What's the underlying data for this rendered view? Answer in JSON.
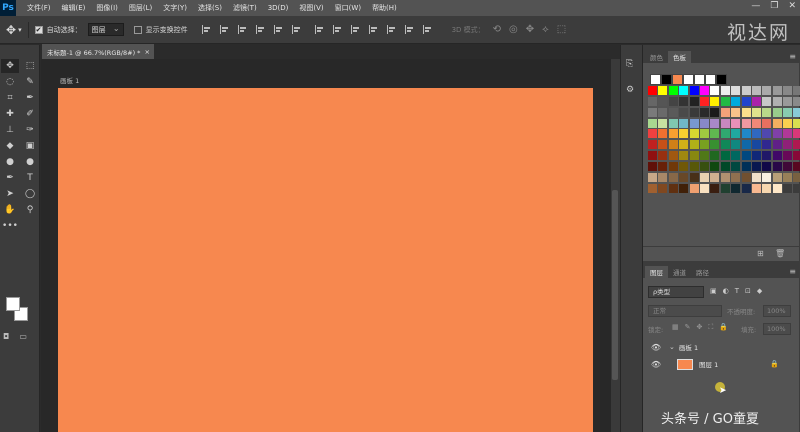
{
  "app": {
    "logo": "Ps"
  },
  "menu": [
    "文件(F)",
    "编辑(E)",
    "图像(I)",
    "图层(L)",
    "文字(Y)",
    "选择(S)",
    "滤镜(T)",
    "3D(D)",
    "视图(V)",
    "窗口(W)",
    "帮助(H)"
  ],
  "window_controls": [
    "—",
    "❐",
    "✕"
  ],
  "options": {
    "auto_select_label": "自动选择：",
    "auto_select_value": "图层",
    "show_transform_label": "显示变换控件",
    "mode_3d_label": "3D 模式："
  },
  "watermark_top": "视达网",
  "document": {
    "tab_title": "未标题-1 @ 66.7%(RGB/8#) *",
    "tab_close": "×",
    "artboard_label": "画板 1",
    "canvas_color": "#f7884f"
  },
  "swatches_panel": {
    "tabs": [
      "颜色",
      "色板"
    ],
    "active_tab": "色板",
    "recent": [
      "#ffffff",
      "#000000",
      "#f7884f",
      "#ffffff",
      "#ffffff",
      "#ffffff",
      "#000000"
    ],
    "rows": [
      [
        "#ff0000",
        "#ffff00",
        "#00ff00",
        "#00ffff",
        "#0000ff",
        "#ff00ff",
        "#ffffff",
        "#eeeeee",
        "#dddddd",
        "#cccccc",
        "#bbbbbb",
        "#aaaaaa",
        "#999999",
        "#888888",
        "#777777"
      ],
      [
        "#666666",
        "#555555",
        "#444444",
        "#333333",
        "#222222",
        "#ff2222",
        "#ffee00",
        "#22bb44",
        "#00aadd",
        "#2244cc",
        "#aa22aa",
        "#c8c8c8",
        "#b0b0b0",
        "#9a9a9a",
        "#8a8a8a"
      ],
      [
        "#7a7a7a",
        "#6a6a6a",
        "#5a5a5a",
        "#4a4a4a",
        "#3a3a3a",
        "#2a2a2a",
        "#1a1a1a",
        "#f4a27a",
        "#f8c28a",
        "#fbe08c",
        "#e0e28c",
        "#b8d88a",
        "#98cc8c",
        "#88ccb0",
        "#88ccd8"
      ],
      [
        "#a8d890",
        "#c8e0a0",
        "#80c8b0",
        "#70b8c8",
        "#7898d0",
        "#8888c8",
        "#a888c8",
        "#c888c0",
        "#e890b8",
        "#f098a0",
        "#f08878",
        "#e87060",
        "#f4b060",
        "#f8d050",
        "#d8e050"
      ],
      [
        "#f04040",
        "#f07030",
        "#f8a030",
        "#f8d030",
        "#d8d830",
        "#a0c840",
        "#60b850",
        "#30a870",
        "#20a8a0",
        "#2088c8",
        "#3068c0",
        "#5048b0",
        "#8040a8",
        "#b03898",
        "#d83878"
      ],
      [
        "#c02020",
        "#c85018",
        "#d08018",
        "#d0b018",
        "#b0b018",
        "#78a020",
        "#389030",
        "#108858",
        "#108880",
        "#1068a8",
        "#1848a0",
        "#302890",
        "#602088",
        "#902078",
        "#b01850"
      ],
      [
        "#901010",
        "#983010",
        "#a05810",
        "#a08810",
        "#888810",
        "#507818",
        "#206820",
        "#006840",
        "#006860",
        "#004880",
        "#102878",
        "#201868",
        "#400868",
        "#680858",
        "#880838"
      ],
      [
        "#601008",
        "#682008",
        "#703808",
        "#705808",
        "#585808",
        "#385010",
        "#104810",
        "#004828",
        "#004840",
        "#003058",
        "#081850",
        "#100848",
        "#280848",
        "#400838",
        "#580820"
      ],
      [
        "#c8a888",
        "#a88868",
        "#886848",
        "#684828",
        "#483018",
        "#e8d0b0",
        "#d0b090",
        "#b09070",
        "#907050",
        "#705030",
        "#f0e0c8",
        "#f8f0e0",
        "#b8a078",
        "#988058",
        "#786040"
      ],
      [
        "#a06030",
        "#804820",
        "#603010",
        "#402008",
        "#f0a070",
        "#f8e0c0",
        "#3a1e10",
        "#204030",
        "#102830",
        "#182848",
        "#f8b890",
        "#f8d8b0",
        "#ffe8c8",
        "#3c3c3c",
        "#3c3c3c"
      ]
    ]
  },
  "layers_panel": {
    "tabs": [
      "图层",
      "通道",
      "路径"
    ],
    "active_tab": "图层",
    "filter_label": "ρ类型",
    "filter_icons": [
      "▣",
      "◐",
      "T",
      "⊡",
      "◆"
    ],
    "blend_mode": "正常",
    "opacity_label": "不透明度:",
    "opacity_value": "100%",
    "lock_label": "锁定:",
    "lock_icons": [
      "▦",
      "✎",
      "✥",
      "⛶",
      "🔒"
    ],
    "fill_label": "填充:",
    "fill_value": "100%",
    "group_name": "画板 1",
    "layer_name": "图层 1"
  },
  "bottom_watermark": "头条号 / GO童夏"
}
